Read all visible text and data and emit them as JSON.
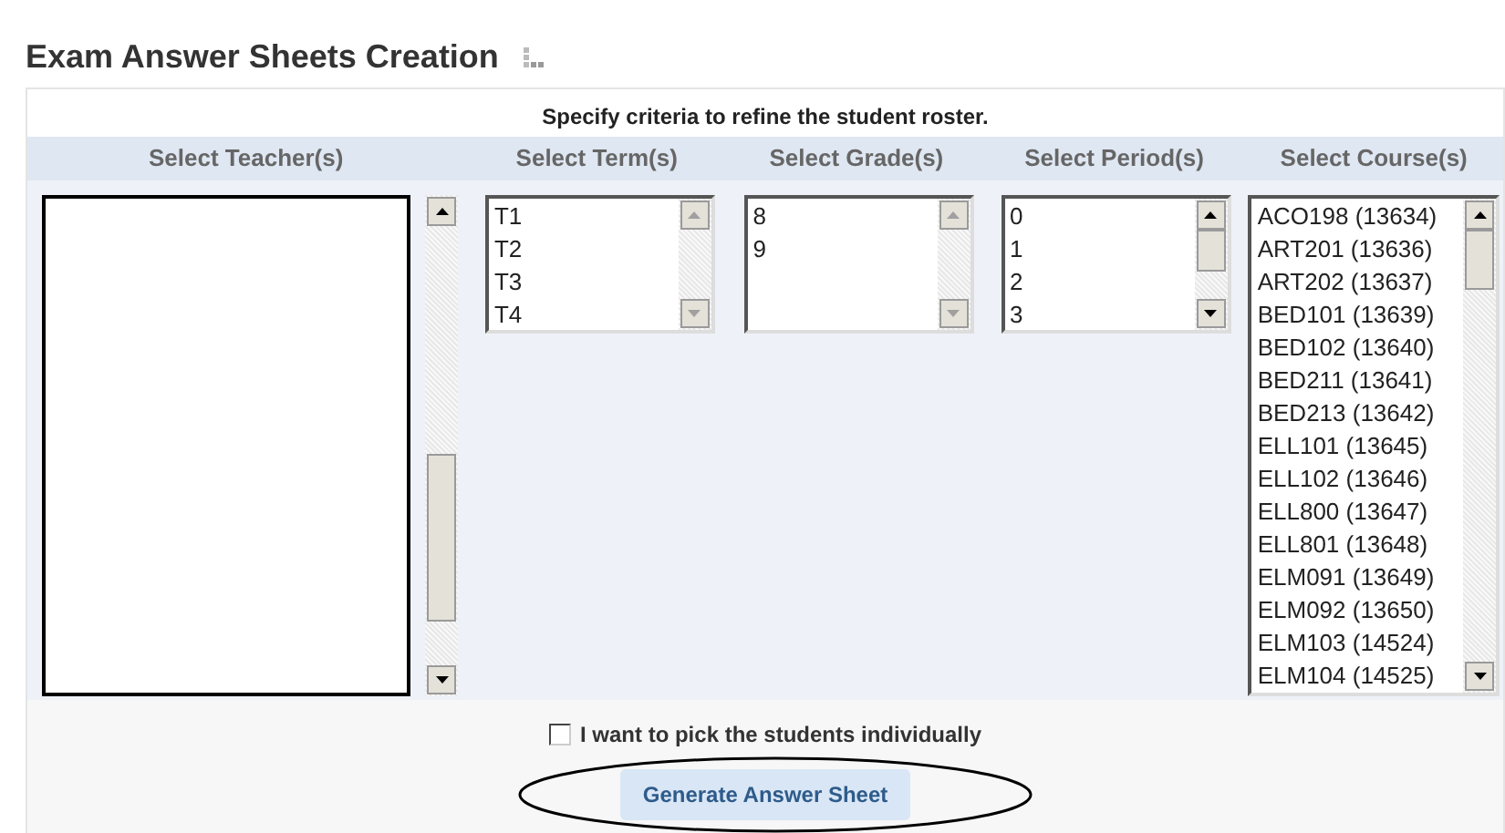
{
  "page_title": "Exam Answer Sheets Creation",
  "instructions": "Specify criteria to refine the student roster.",
  "selectors": [
    {
      "heading": "Select Teacher(s)",
      "kind": "redacted"
    },
    {
      "heading": "Select Term(s)",
      "kind": "short",
      "scrollable": false,
      "options": [
        "T1",
        "T2",
        "T3",
        "T4"
      ]
    },
    {
      "heading": "Select Grade(s)",
      "kind": "short",
      "scrollable": false,
      "options": [
        "8",
        "9"
      ]
    },
    {
      "heading": "Select Period(s)",
      "kind": "short",
      "scrollable": true,
      "options": [
        "0",
        "1",
        "2",
        "3"
      ]
    },
    {
      "heading": "Select Course(s)",
      "kind": "long",
      "options": [
        "ACO198 (13634)",
        "ART201 (13636)",
        "ART202 (13637)",
        "BED101 (13639)",
        "BED102 (13640)",
        "BED211 (13641)",
        "BED213 (13642)",
        "ELL101 (13645)",
        "ELL102 (13646)",
        "ELL800 (13647)",
        "ELL801 (13648)",
        "ELM091 (13649)",
        "ELM092 (13650)",
        "ELM103 (14524)",
        "ELM104 (14525)"
      ]
    }
  ],
  "pick_individually": {
    "label": "I want to pick the students individually",
    "checked": false
  },
  "generate_button": "Generate Answer Sheet"
}
